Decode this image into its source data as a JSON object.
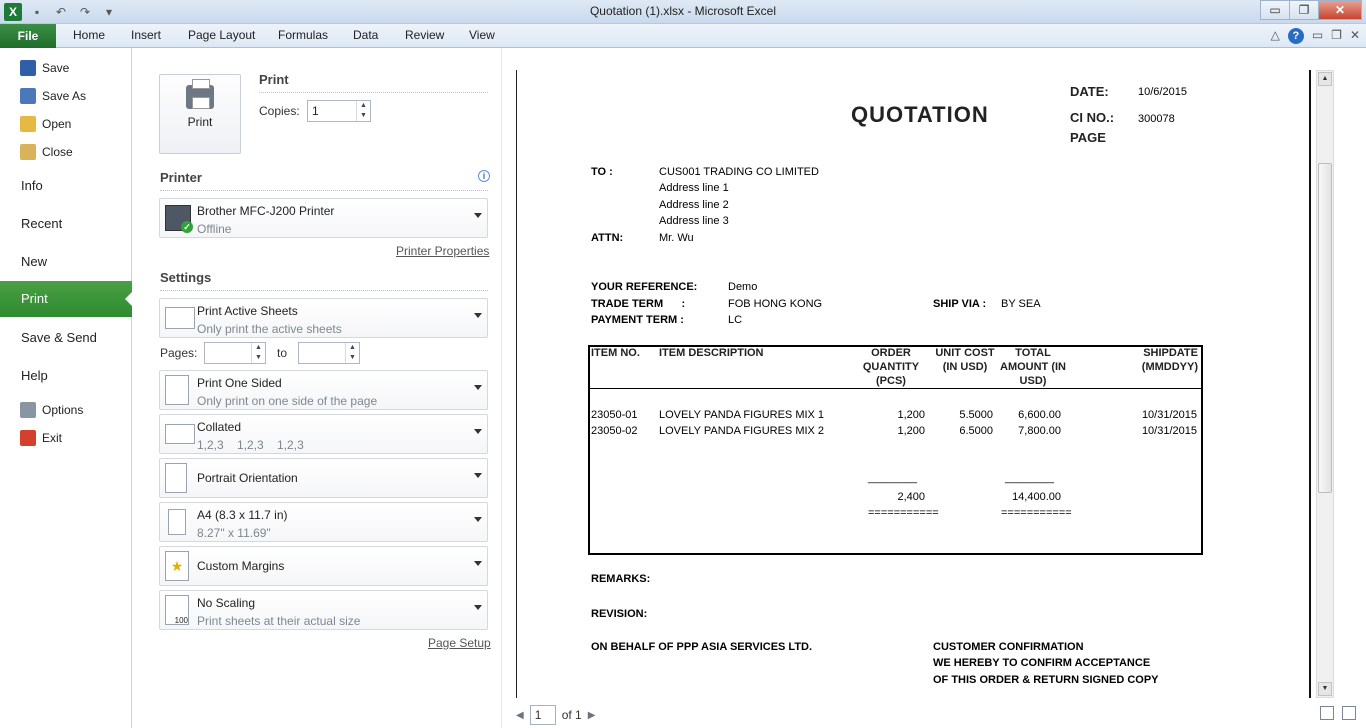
{
  "window": {
    "title": "Quotation (1).xlsx - Microsoft Excel",
    "controls": {
      "minimize": "▭",
      "restore": "❐",
      "close": "✕"
    }
  },
  "qat": {
    "save_icon": "save-icon",
    "undo_icon": "undo-icon",
    "redo_icon": "redo-icon"
  },
  "ribbon": {
    "tabs": [
      "File",
      "Home",
      "Insert",
      "Page Layout",
      "Formulas",
      "Data",
      "Review",
      "View"
    ]
  },
  "backstage": {
    "commands": [
      "Save",
      "Save As",
      "Open",
      "Close"
    ],
    "tabs": [
      "Info",
      "Recent",
      "New",
      "Print",
      "Save & Send",
      "Help"
    ],
    "bottom": [
      "Options",
      "Exit"
    ],
    "selected": "Print"
  },
  "print": {
    "section_title": "Print",
    "button_label": "Print",
    "copies_label": "Copies:",
    "copies_value": "1",
    "printer_title": "Printer",
    "printer_name": "Brother MFC-J200 Printer",
    "printer_status": "Offline",
    "printer_properties": "Printer Properties",
    "settings_title": "Settings",
    "sheets_l1": "Print Active Sheets",
    "sheets_l2": "Only print the active sheets",
    "pages_label": "Pages:",
    "pages_to": "to",
    "pages_from_value": "",
    "pages_to_value": "",
    "sided_l1": "Print One Sided",
    "sided_l2": "Only print on one side of the page",
    "collated_l1": "Collated",
    "collated_l2": "1,2,3    1,2,3    1,2,3",
    "orientation": "Portrait Orientation",
    "paper_l1": "A4 (8.3 x 11.7 in)",
    "paper_l2": "8.27\" x 11.69\"",
    "margins": "Custom Margins",
    "scaling_l1": "No Scaling",
    "scaling_l2": "Print sheets at their actual size",
    "page_setup": "Page Setup"
  },
  "preview": {
    "current_page": "1",
    "of_pages": "of 1"
  },
  "document": {
    "title": "QUOTATION",
    "date_label": "DATE:",
    "date_value": "10/6/2015",
    "cino_label": "CI NO.:",
    "cino_value": "300078",
    "page_label": "PAGE",
    "to_label": "TO :",
    "to_lines": [
      "CUS001 TRADING CO LIMITED",
      "Address line 1",
      "Address line 2",
      "Address line 3"
    ],
    "attn_label": "ATTN:",
    "attn_value": "Mr. Wu",
    "ref_label": "YOUR REFERENCE:",
    "ref_value": "Demo",
    "trade_label": "TRADE TERM      :",
    "trade_value": "FOB HONG KONG",
    "shipvia_label": "SHIP VIA :",
    "shipvia_value": "BY SEA",
    "payment_label": "PAYMENT TERM :",
    "payment_value": "LC",
    "headers": {
      "item_no": "ITEM NO.",
      "desc": "ITEM DESCRIPTION",
      "qty": "ORDER\nQUANTITY\n(PCS)",
      "cost": "UNIT COST\n(IN USD)",
      "amount": "TOTAL\nAMOUNT (IN\nUSD)",
      "ship": "SHIPDATE\n(MMDDYY)"
    },
    "rows": [
      {
        "item": "23050-01",
        "desc": "LOVELY PANDA FIGURES MIX 1",
        "qty": "1,200",
        "cost": "5.5000",
        "amount": "6,600.00",
        "ship": "10/31/2015"
      },
      {
        "item": "23050-02",
        "desc": "LOVELY PANDA FIGURES MIX 2",
        "qty": "1,200",
        "cost": "6.5000",
        "amount": "7,800.00",
        "ship": "10/31/2015"
      }
    ],
    "dash_line": "________",
    "total_qty": "2,400",
    "total_amount": "14,400.00",
    "eq_line": "===========",
    "remarks": "REMARKS:",
    "revision": "REVISION:",
    "behalf": "ON BEHALF OF PPP ASIA SERVICES LTD.",
    "confirm_1": "CUSTOMER CONFIRMATION",
    "confirm_2": "WE HEREBY TO CONFIRM ACCEPTANCE",
    "confirm_3": "OF THIS ORDER & RETURN SIGNED COPY"
  },
  "colors": {
    "accent_green": "#2f8a30",
    "ribbon_blue": "#dde8f5"
  }
}
